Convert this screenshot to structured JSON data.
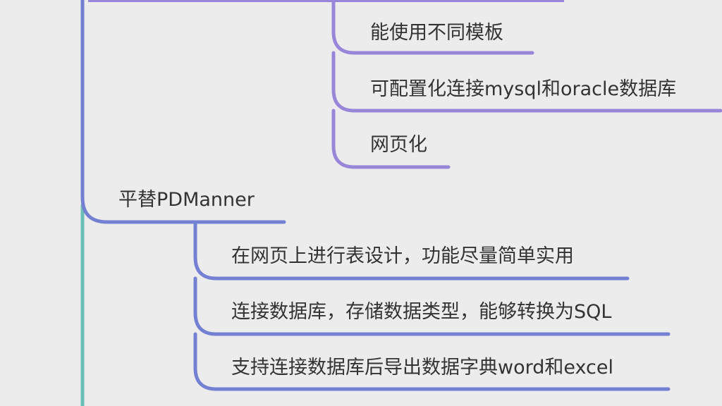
{
  "colors": {
    "background": "#ececec",
    "branch_blue": "#7480d2",
    "branch_purple": "#9a86d8",
    "trunk_teal": "#6cbfb6",
    "text": "#333333"
  },
  "mindmap": {
    "upper_children": [
      "能使用不同模板",
      "可配置化连接mysql和oracle数据库",
      "网页化"
    ],
    "topic": "平替PDManner",
    "topic_children": [
      "在网页上进行表设计，功能尽量简单实用",
      "连接数据库，存储数据类型，能够转换为SQL",
      "支持连接数据库后导出数据字典word和excel"
    ]
  }
}
